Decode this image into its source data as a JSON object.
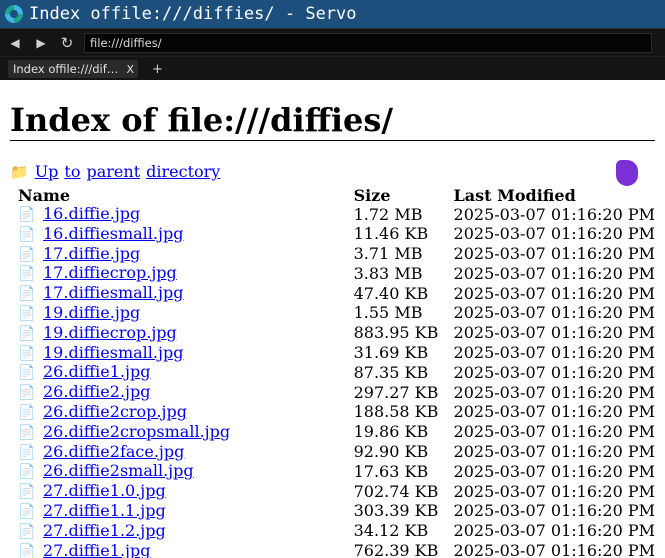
{
  "window": {
    "title": "Index offile:///diffies/ - Servo"
  },
  "toolbar": {
    "back_icon": "back-arrow-icon",
    "forward_icon": "forward-arrow-icon",
    "reload_icon": "reload-icon",
    "url": "file:///diffies/"
  },
  "tabs": [
    {
      "label": "Index offile:///dif…",
      "close": "X"
    }
  ],
  "new_tab_label": "+",
  "page": {
    "heading": "Index of file:///diffies/",
    "updir": {
      "words": [
        "Up",
        "to",
        "parent",
        "directory"
      ]
    },
    "columns": {
      "name": "Name",
      "size": "Size",
      "modified": "Last Modified"
    },
    "files": [
      {
        "name": "16.diffie.jpg",
        "size": "1.72 MB",
        "modified": "2025-03-07 01:16:20 PM"
      },
      {
        "name": "16.diffiesmall.jpg",
        "size": "11.46 KB",
        "modified": "2025-03-07 01:16:20 PM"
      },
      {
        "name": "17.diffie.jpg",
        "size": "3.71 MB",
        "modified": "2025-03-07 01:16:20 PM"
      },
      {
        "name": "17.diffiecrop.jpg",
        "size": "3.83 MB",
        "modified": "2025-03-07 01:16:20 PM"
      },
      {
        "name": "17.diffiesmall.jpg",
        "size": "47.40 KB",
        "modified": "2025-03-07 01:16:20 PM"
      },
      {
        "name": "19.diffie.jpg",
        "size": "1.55 MB",
        "modified": "2025-03-07 01:16:20 PM"
      },
      {
        "name": "19.diffiecrop.jpg",
        "size": "883.95 KB",
        "modified": "2025-03-07 01:16:20 PM"
      },
      {
        "name": "19.diffiesmall.jpg",
        "size": "31.69 KB",
        "modified": "2025-03-07 01:16:20 PM"
      },
      {
        "name": "26.diffie1.jpg",
        "size": "87.35 KB",
        "modified": "2025-03-07 01:16:20 PM"
      },
      {
        "name": "26.diffie2.jpg",
        "size": "297.27 KB",
        "modified": "2025-03-07 01:16:20 PM"
      },
      {
        "name": "26.diffie2crop.jpg",
        "size": "188.58 KB",
        "modified": "2025-03-07 01:16:20 PM"
      },
      {
        "name": "26.diffie2cropsmall.jpg",
        "size": "19.86 KB",
        "modified": "2025-03-07 01:16:20 PM"
      },
      {
        "name": "26.diffie2face.jpg",
        "size": "92.90 KB",
        "modified": "2025-03-07 01:16:20 PM"
      },
      {
        "name": "26.diffie2small.jpg",
        "size": "17.63 KB",
        "modified": "2025-03-07 01:16:20 PM"
      },
      {
        "name": "27.diffie1.0.jpg",
        "size": "702.74 KB",
        "modified": "2025-03-07 01:16:20 PM"
      },
      {
        "name": "27.diffie1.1.jpg",
        "size": "303.39 KB",
        "modified": "2025-03-07 01:16:20 PM"
      },
      {
        "name": "27.diffie1.2.jpg",
        "size": "34.12 KB",
        "modified": "2025-03-07 01:16:20 PM"
      },
      {
        "name": "27.diffie1.jpg",
        "size": "762.39 KB",
        "modified": "2025-03-07 01:16:20 PM"
      }
    ]
  },
  "colors": {
    "titlebar": "#1d4f7c",
    "toolbar": "#141414",
    "link": "#0000ee",
    "cursor": "#7b2fd6"
  }
}
